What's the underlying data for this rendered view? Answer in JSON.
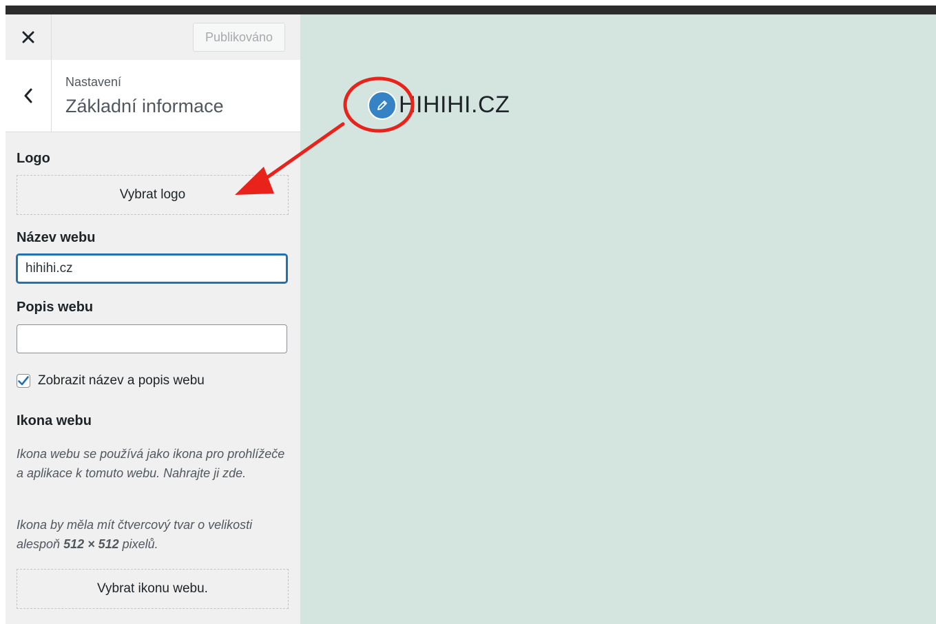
{
  "header": {
    "close_label": "×",
    "publish_label": "Publikováno"
  },
  "section": {
    "breadcrumb": "Nastavení",
    "title": "Základní informace"
  },
  "logo": {
    "label": "Logo",
    "button_label": "Vybrat logo"
  },
  "site_title": {
    "label": "Název webu",
    "value": "hihihi.cz"
  },
  "tagline": {
    "label": "Popis webu",
    "value": ""
  },
  "display_title": {
    "checked": true,
    "label": "Zobrazit název a popis webu"
  },
  "site_icon": {
    "label": "Ikona webu",
    "desc_1": "Ikona webu se používá jako ikona pro prohlížeče a aplikace k tomuto webu. Nahrajte ji zde.",
    "desc_2_prefix": "Ikona by měla mít čtvercový tvar o velikosti alespoň ",
    "desc_2_size": "512 × 512",
    "desc_2_suffix": " pixelů.",
    "button_label": "Vybrat ikonu webu."
  },
  "preview": {
    "site_title": "HIHIHI.CZ",
    "edit_icon": "pencil-icon"
  },
  "colors": {
    "preview_bg": "#d4e4de",
    "accent": "#2271b1",
    "annotation": "#e8231b",
    "edit_shortcut": "#3582c4"
  }
}
